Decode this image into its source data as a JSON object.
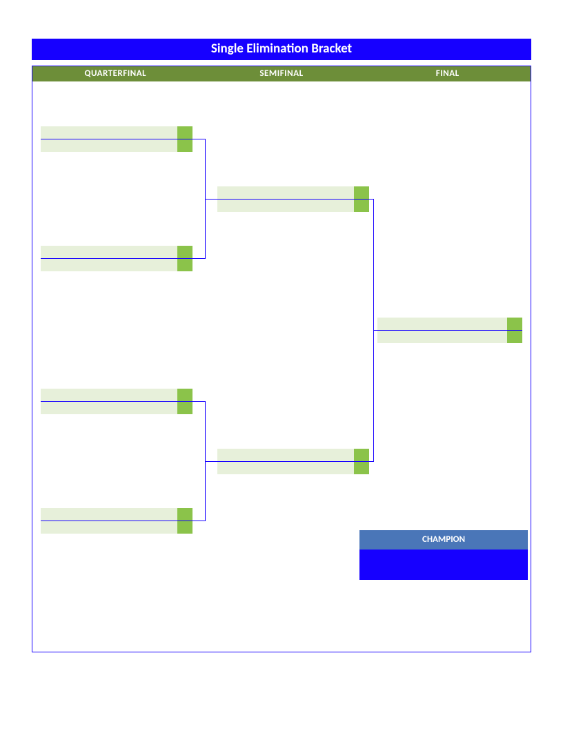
{
  "title": "Single Elimination Bracket",
  "rounds": {
    "qf": "QUARTERFINAL",
    "sf": "SEMIFINAL",
    "f": "FINAL"
  },
  "champion_label": "CHAMPION",
  "matches": {
    "qf1": {
      "team_a": "",
      "score_a": "",
      "team_b": "",
      "score_b": ""
    },
    "qf2": {
      "team_a": "",
      "score_a": "",
      "team_b": "",
      "score_b": ""
    },
    "qf3": {
      "team_a": "",
      "score_a": "",
      "team_b": "",
      "score_b": ""
    },
    "qf4": {
      "team_a": "",
      "score_a": "",
      "team_b": "",
      "score_b": ""
    },
    "sf1": {
      "team_a": "",
      "score_a": "",
      "team_b": "",
      "score_b": ""
    },
    "sf2": {
      "team_a": "",
      "score_a": "",
      "team_b": "",
      "score_b": ""
    },
    "f1": {
      "team_a": "",
      "score_a": "",
      "team_b": "",
      "score_b": ""
    }
  },
  "champion_name": ""
}
